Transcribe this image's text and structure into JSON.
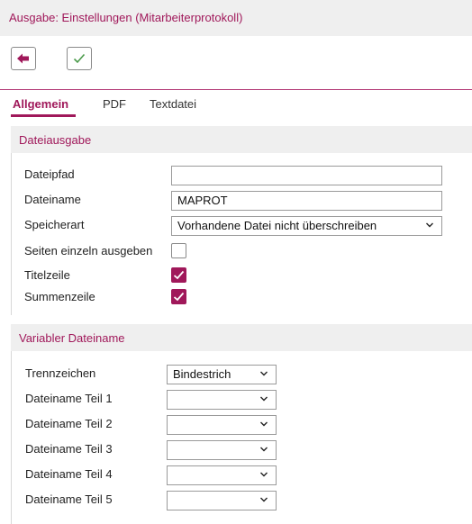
{
  "window": {
    "title": "Ausgabe: Einstellungen (Mitarbeiterprotokoll)"
  },
  "toolbar": {
    "back_icon": "arrow-left-icon",
    "confirm_icon": "checkmark-icon"
  },
  "tabs": [
    {
      "label": "Allgemein",
      "active": true
    },
    {
      "label": "PDF",
      "active": false
    },
    {
      "label": "Textdatei",
      "active": false
    }
  ],
  "colors": {
    "accent": "#a0185a",
    "header_bg": "#efefef"
  },
  "dateiausgabe": {
    "heading": "Dateiausgabe",
    "dateipfad": {
      "label": "Dateipfad",
      "value": ""
    },
    "dateiname": {
      "label": "Dateiname",
      "value": "MAPROT"
    },
    "speicherart": {
      "label": "Speicherart",
      "value": "Vorhandene Datei nicht überschreiben"
    },
    "seiten_einzeln": {
      "label": "Seiten einzeln ausgeben",
      "checked": false
    },
    "titelzeile": {
      "label": "Titelzeile",
      "checked": true
    },
    "summenzeile": {
      "label": "Summenzeile",
      "checked": true
    }
  },
  "variabler": {
    "heading": "Variabler Dateiname",
    "trennzeichen": {
      "label": "Trennzeichen",
      "value": "Bindestrich"
    },
    "teile": [
      {
        "label": "Dateiname Teil 1",
        "value": ""
      },
      {
        "label": "Dateiname Teil 2",
        "value": ""
      },
      {
        "label": "Dateiname Teil 3",
        "value": ""
      },
      {
        "label": "Dateiname Teil 4",
        "value": ""
      },
      {
        "label": "Dateiname Teil 5",
        "value": ""
      }
    ]
  }
}
